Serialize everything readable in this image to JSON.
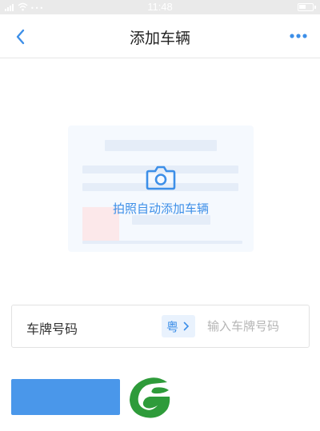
{
  "status_bar": {
    "time": "11:48",
    "icons": [
      "signal-icon",
      "wifi-icon",
      "battery-icon"
    ]
  },
  "nav": {
    "title": "添加车辆",
    "back_icon": "chevron-left-icon",
    "more_icon": "more-horizontal-icon"
  },
  "photo_card": {
    "label": "拍照自动添加车辆",
    "icon": "camera-icon"
  },
  "plate": {
    "label": "车牌号码",
    "province": "粤",
    "placeholder": "输入车牌号码",
    "value": ""
  },
  "submit": {
    "label": ""
  },
  "logo": {
    "icon": "leaf-logo-icon"
  },
  "colors": {
    "accent": "#4a97ea",
    "accent_text": "#3d8fe8",
    "card_bg": "#f5f9fe",
    "logo_green": "#2e9b3a"
  }
}
